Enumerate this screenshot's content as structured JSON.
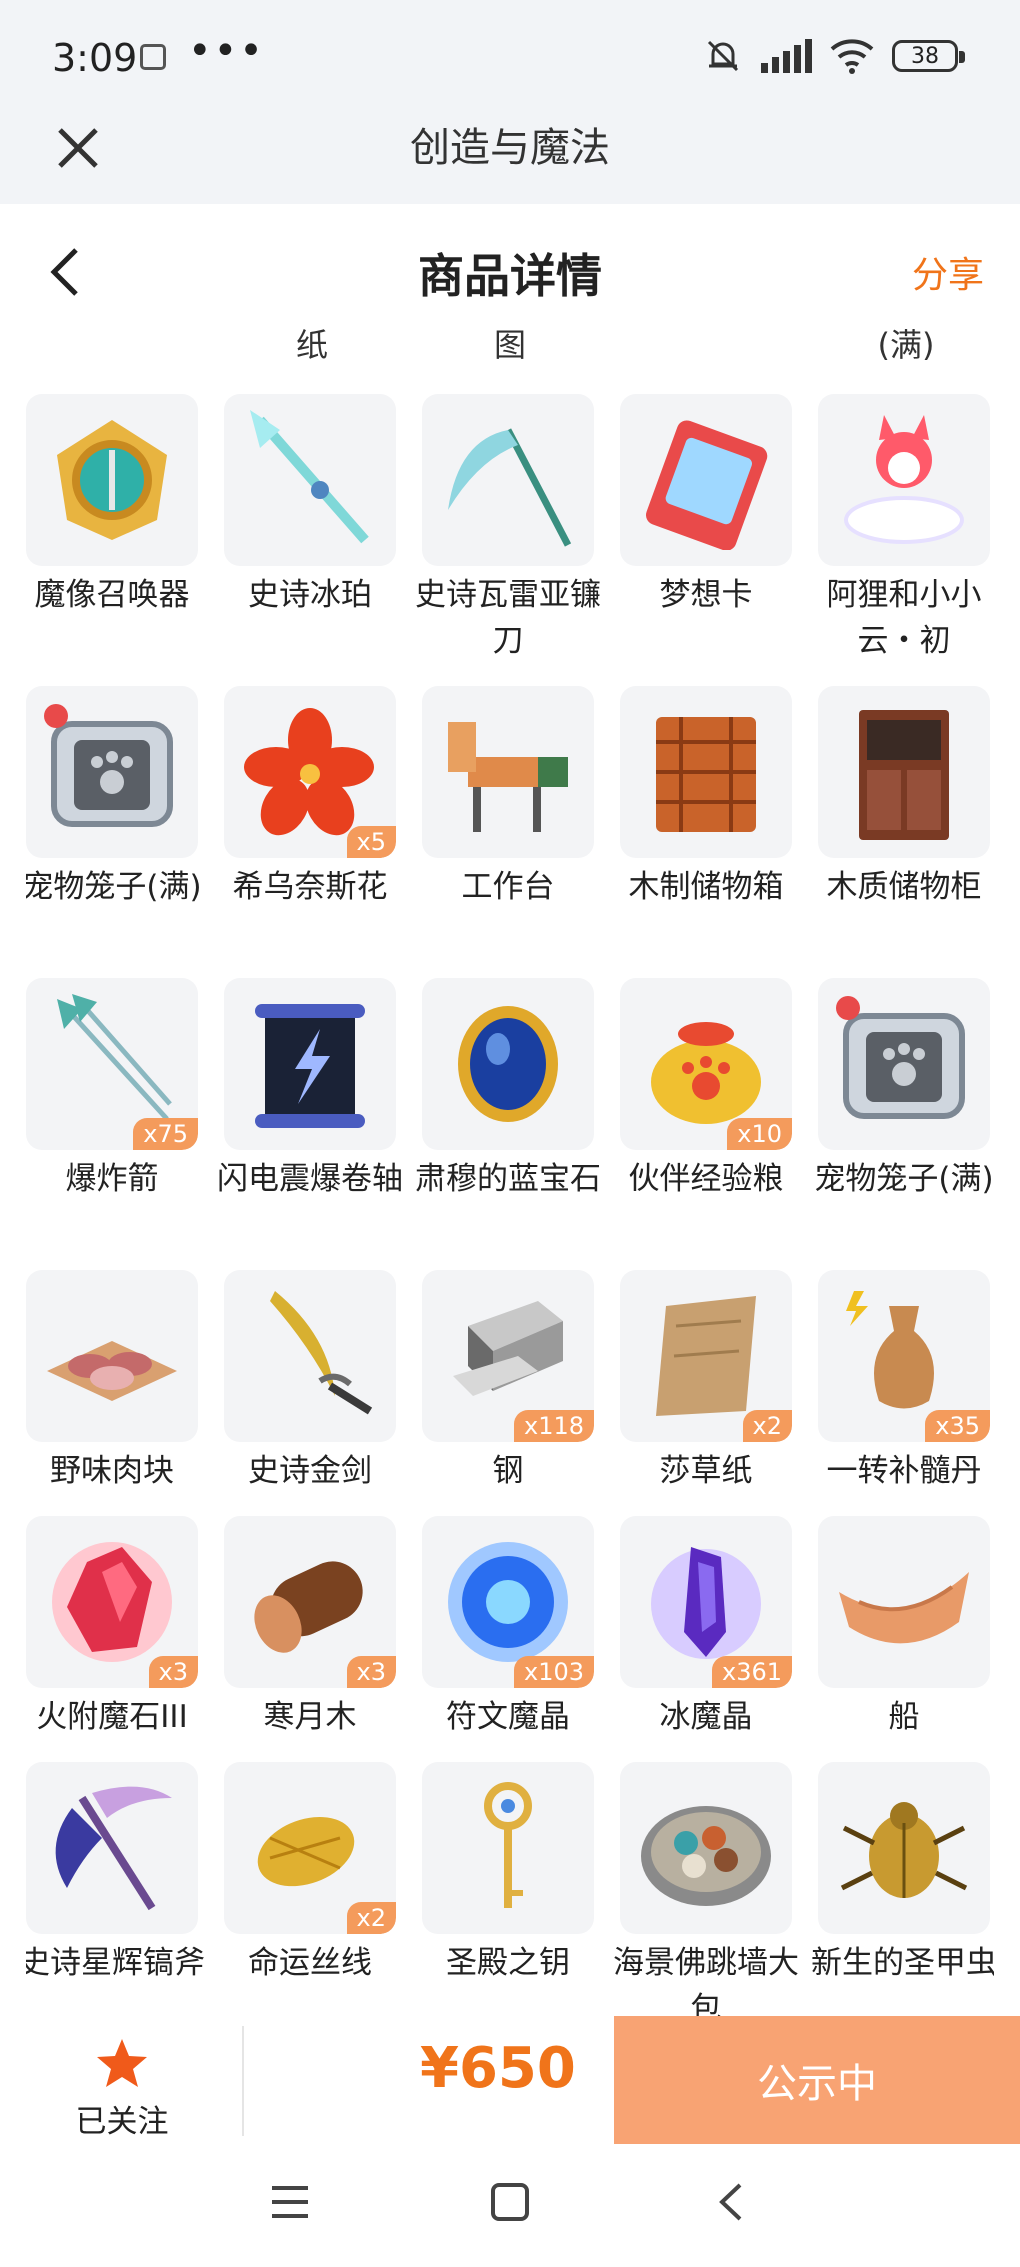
{
  "status": {
    "time": "3:09",
    "dots": "•••",
    "battery": "38"
  },
  "app": {
    "title": "创造与魔法"
  },
  "nav": {
    "title": "商品详情",
    "share": "分享"
  },
  "partial_row": [
    "纸",
    "图",
    "(满)"
  ],
  "items": [
    {
      "name": "魔像召唤器",
      "qty": "",
      "icon": "compass-emblem-icon"
    },
    {
      "name": "史诗冰珀",
      "qty": "",
      "icon": "ice-spear-icon"
    },
    {
      "name": "史诗瓦雷亚镰刀",
      "qty": "",
      "icon": "scythe-icon"
    },
    {
      "name": "梦想卡",
      "qty": "",
      "icon": "dream-card-icon"
    },
    {
      "name": "阿狸和小小云・初",
      "qty": "",
      "icon": "fox-cloud-icon"
    },
    {
      "name": "宠物笼子(满)",
      "qty": "",
      "icon": "pet-cage-icon"
    },
    {
      "name": "希乌奈斯花",
      "qty": "x5",
      "icon": "red-flower-icon"
    },
    {
      "name": "工作台",
      "qty": "",
      "icon": "workbench-horse-icon"
    },
    {
      "name": "木制储物箱",
      "qty": "",
      "icon": "wooden-crate-icon"
    },
    {
      "name": "木质储物柜",
      "qty": "",
      "icon": "wooden-cabinet-icon"
    },
    {
      "name": "爆炸箭",
      "qty": "x75",
      "icon": "arrow-icon"
    },
    {
      "name": "闪电震爆卷轴",
      "qty": "",
      "icon": "lightning-scroll-icon"
    },
    {
      "name": "肃穆的蓝宝石",
      "qty": "",
      "icon": "sapphire-icon"
    },
    {
      "name": "伙伴经验粮",
      "qty": "x10",
      "icon": "food-bag-icon"
    },
    {
      "name": "宠物笼子(满)",
      "qty": "",
      "icon": "pet-cage-icon"
    },
    {
      "name": "野味肉块",
      "qty": "",
      "icon": "meat-icon"
    },
    {
      "name": "史诗金剑",
      "qty": "",
      "icon": "golden-blade-icon"
    },
    {
      "name": "钢",
      "qty": "x118",
      "icon": "steel-ingot-icon"
    },
    {
      "name": "莎草纸",
      "qty": "x2",
      "icon": "papyrus-icon"
    },
    {
      "name": "一转补髓丹",
      "qty": "x35",
      "icon": "vase-icon"
    },
    {
      "name": "火附魔石III",
      "qty": "x3",
      "icon": "fire-crystal-icon"
    },
    {
      "name": "寒月木",
      "qty": "x3",
      "icon": "log-icon"
    },
    {
      "name": "符文魔晶",
      "qty": "x103",
      "icon": "rune-orb-icon"
    },
    {
      "name": "冰魔晶",
      "qty": "x361",
      "icon": "ice-crystal-icon"
    },
    {
      "name": "船",
      "qty": "",
      "icon": "boat-icon"
    },
    {
      "name": "史诗星辉镐斧",
      "qty": "",
      "icon": "star-axe-icon"
    },
    {
      "name": "命运丝线",
      "qty": "x2",
      "icon": "thread-icon"
    },
    {
      "name": "圣殿之钥",
      "qty": "",
      "icon": "key-icon"
    },
    {
      "name": "海景佛跳墙大包",
      "qty": "",
      "icon": "dish-icon"
    },
    {
      "name": "新生的圣甲虫",
      "qty": "",
      "icon": "scarab-icon"
    }
  ],
  "bottom": {
    "follow_label": "已关注",
    "price": "¥650",
    "button": "公示中"
  },
  "colors": {
    "accent": "#f0741a",
    "button": "#f8a373",
    "badge": "#f49b5c",
    "tile": "#f3f4f6"
  }
}
